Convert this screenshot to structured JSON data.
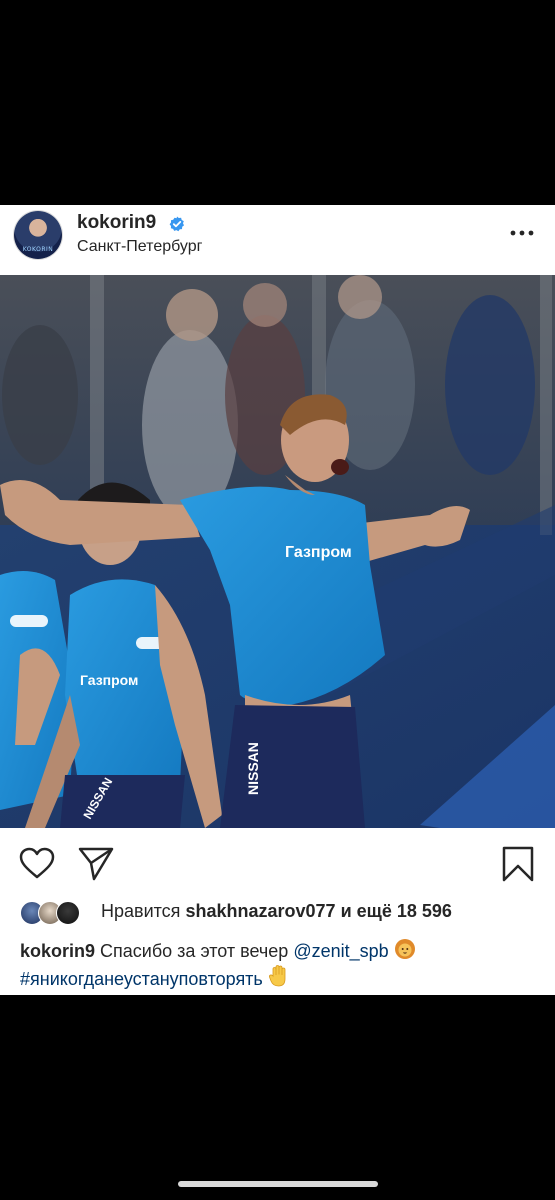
{
  "post": {
    "username": "kokorin9",
    "location": "Санкт-Петербург",
    "avatar_caption": "KOKORIN",
    "photo": {
      "shirt_sponsor": "Газпром",
      "shorts_sponsor": "NISSAN",
      "colors": {
        "jersey": "#1e8ed6",
        "shorts": "#1d2a5c",
        "background": "#2b3f66"
      }
    },
    "likes": {
      "prefix": "Нравится",
      "user": "shakhnazarov077",
      "suffix": "и ещё 18 596"
    },
    "caption": {
      "username": "kokorin9",
      "text": "Спасибо за этот вечер",
      "mention": "@zenit_spb",
      "hashtag": "#яникогданеустануповторять"
    },
    "icons": {
      "verified": "verified-badge-icon",
      "more": "more-options-icon",
      "like": "heart-icon",
      "share": "paper-plane-icon",
      "save": "bookmark-icon"
    },
    "accent_colors": {
      "verified": "#3897f0",
      "link": "#003569",
      "text": "#262626"
    }
  }
}
